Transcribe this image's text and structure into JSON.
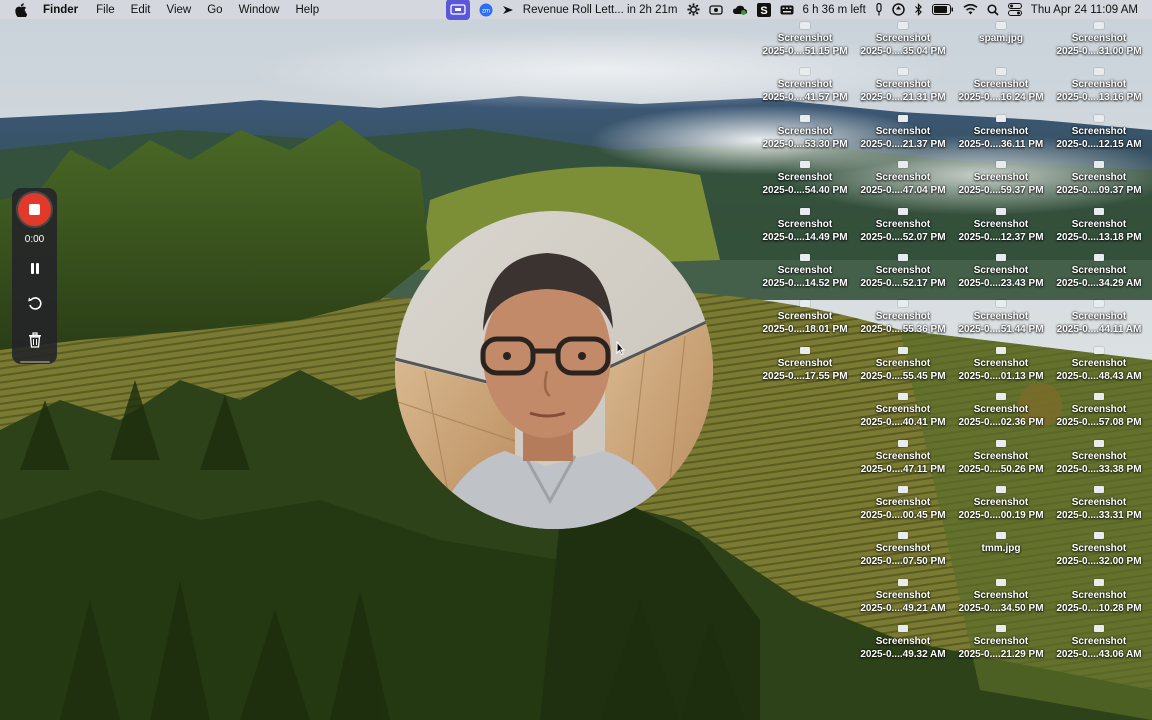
{
  "menubar": {
    "app_name": "Finder",
    "menus": [
      "File",
      "Edit",
      "View",
      "Go",
      "Window",
      "Help"
    ],
    "calendar_event": "Revenue Roll Lett... in 2h 21m",
    "battery_remaining": "6 h 36 m left",
    "datetime": "Thu Apr 24  11:09 AM",
    "status_icons": [
      "screen-recording-icon",
      "zoom-icon",
      "calendar-event-icon",
      "gear-icon",
      "camera-icon",
      "cloud-icon",
      "s-app-icon",
      "keyboard-icon",
      "mic-icon",
      "recycle-icon",
      "bluetooth-icon",
      "battery-icon",
      "wifi-icon",
      "search-icon",
      "control-center-icon"
    ]
  },
  "recorder": {
    "time": "0:00",
    "stop_color": "#e23a2a"
  },
  "desktop": {
    "columns": [
      {
        "items": [
          {
            "name": "Screenshot",
            "sub": "2025-0....51.15 PM"
          },
          {
            "name": "Screenshot",
            "sub": "2025-0....41.57 PM"
          },
          {
            "name": "Screenshot",
            "sub": "2025-0....53.30 PM"
          },
          {
            "name": "Screenshot",
            "sub": "2025-0....54.40 PM"
          },
          {
            "name": "Screenshot",
            "sub": "2025-0....14.49 PM"
          },
          {
            "name": "Screenshot",
            "sub": "2025-0....14.52 PM"
          },
          {
            "name": "Screenshot",
            "sub": "2025-0....18.01 PM"
          },
          {
            "name": "Screenshot",
            "sub": "2025-0....17.55 PM"
          }
        ]
      },
      {
        "items": [
          {
            "name": "Screenshot",
            "sub": "2025-0....35.04 PM"
          },
          {
            "name": "Screenshot",
            "sub": "2025-0....21.31 PM"
          },
          {
            "name": "Screenshot",
            "sub": "2025-0....21.37 PM"
          },
          {
            "name": "Screenshot",
            "sub": "2025-0....47.04 PM"
          },
          {
            "name": "Screenshot",
            "sub": "2025-0....52.07 PM"
          },
          {
            "name": "Screenshot",
            "sub": "2025-0....52.17 PM"
          },
          {
            "name": "Screenshot",
            "sub": "2025-0....55.36 PM"
          },
          {
            "name": "Screenshot",
            "sub": "2025-0....55.45 PM"
          },
          {
            "name": "Screenshot",
            "sub": "2025-0....40.41 PM"
          },
          {
            "name": "Screenshot",
            "sub": "2025-0....47.11 PM"
          },
          {
            "name": "Screenshot",
            "sub": "2025-0....00.45 PM"
          },
          {
            "name": "Screenshot",
            "sub": "2025-0....07.50 PM"
          },
          {
            "name": "Screenshot",
            "sub": "2025-0....49.21 AM"
          },
          {
            "name": "Screenshot",
            "sub": "2025-0....49.32 AM"
          }
        ]
      },
      {
        "items": [
          {
            "name": "spam.jpg",
            "sub": ""
          },
          {
            "name": "Screenshot",
            "sub": "2025-0....16.24 PM"
          },
          {
            "name": "Screenshot",
            "sub": "2025-0....36.11 PM"
          },
          {
            "name": "Screenshot",
            "sub": "2025-0....59.37 PM"
          },
          {
            "name": "Screenshot",
            "sub": "2025-0....12.37 PM"
          },
          {
            "name": "Screenshot",
            "sub": "2025-0....23.43 PM"
          },
          {
            "name": "Screenshot",
            "sub": "2025-0....51.44 PM"
          },
          {
            "name": "Screenshot",
            "sub": "2025-0....01.13 PM"
          },
          {
            "name": "Screenshot",
            "sub": "2025-0....02.36 PM"
          },
          {
            "name": "Screenshot",
            "sub": "2025-0....50.26 PM"
          },
          {
            "name": "Screenshot",
            "sub": "2025-0....00.19 PM"
          },
          {
            "name": "tmm.jpg",
            "sub": ""
          },
          {
            "name": "Screenshot",
            "sub": "2025-0....34.50 PM"
          },
          {
            "name": "Screenshot",
            "sub": "2025-0....21.29 PM"
          }
        ]
      },
      {
        "items": [
          {
            "name": "Screenshot",
            "sub": "2025-0....31.00 PM"
          },
          {
            "name": "Screenshot",
            "sub": "2025-0....13.16 PM"
          },
          {
            "name": "Screenshot",
            "sub": "2025-0....12.15 AM"
          },
          {
            "name": "Screenshot",
            "sub": "2025-0....09.37 PM"
          },
          {
            "name": "Screenshot",
            "sub": "2025-0....13.18 PM"
          },
          {
            "name": "Screenshot",
            "sub": "2025-0....34.29 AM"
          },
          {
            "name": "Screenshot",
            "sub": "2025-0....44.11 AM"
          },
          {
            "name": "Screenshot",
            "sub": "2025-0....48.43 AM"
          },
          {
            "name": "Screenshot",
            "sub": "2025-0....57.08 PM"
          },
          {
            "name": "Screenshot",
            "sub": "2025-0....33.38 PM"
          },
          {
            "name": "Screenshot",
            "sub": "2025-0....33.31 PM"
          },
          {
            "name": "Screenshot",
            "sub": "2025-0....32.00 PM"
          },
          {
            "name": "Screenshot",
            "sub": "2025-0....10.28 PM"
          },
          {
            "name": "Screenshot",
            "sub": "2025-0....43.06 AM"
          }
        ]
      }
    ]
  }
}
